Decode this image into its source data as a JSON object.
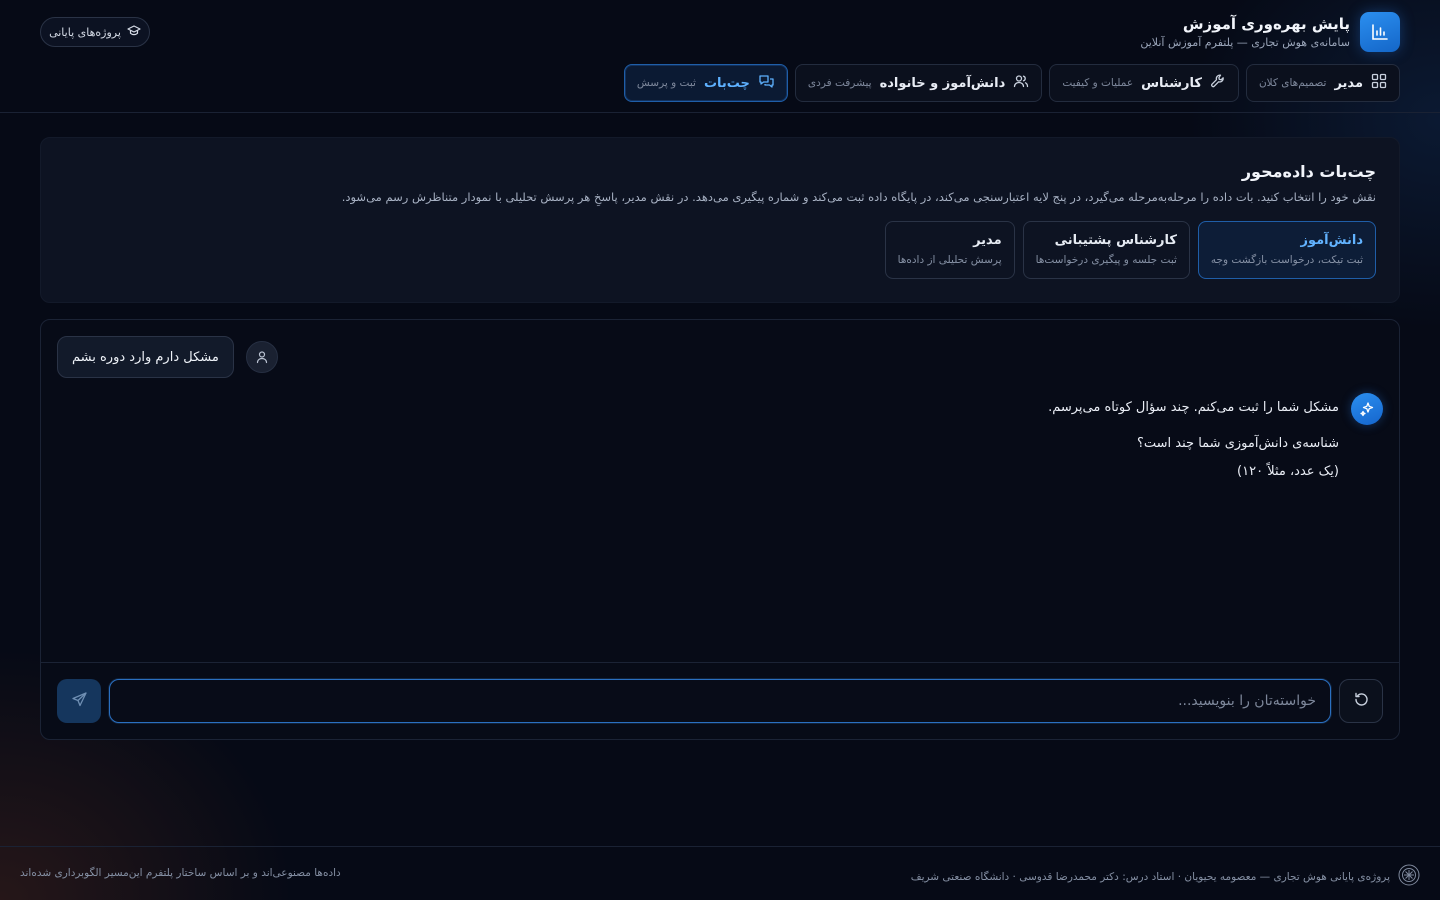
{
  "brand": {
    "title": "پایش بهره‌وری آموزش",
    "subtitle": "سامانه‌ی هوش تجاری — پلتفرم آموزش آنلاین",
    "icon": "bar-chart-icon"
  },
  "header": {
    "projects_label": "پروژه‌های پایانی"
  },
  "nav": {
    "tabs": [
      {
        "title": "مدیر",
        "subtitle": "تصمیم‌های کلان",
        "icon": "grid-icon",
        "active": false
      },
      {
        "title": "کارشناس",
        "subtitle": "عملیات و کیفیت",
        "icon": "wrench-icon",
        "active": false
      },
      {
        "title": "دانش‌آموز و خانواده",
        "subtitle": "پیشرفت فردی",
        "icon": "users-icon",
        "active": false
      },
      {
        "title": "چت‌بات",
        "subtitle": "ثبت و پرسش",
        "icon": "chat-icon",
        "active": true
      }
    ]
  },
  "intro": {
    "title": "چت‌بات داده‌محور",
    "description": "نقش خود را انتخاب کنید. بات داده را مرحله‌به‌مرحله می‌گیرد، در پنج لایه اعتبارسنجی می‌کند، در پایگاه داده ثبت می‌کند و شماره پیگیری می‌دهد. در نقش مدیر، پاسخِ هر پرسش تحلیلی با نمودار متناظرش رسم می‌شود.",
    "roles": [
      {
        "title": "دانش‌آموز",
        "subtitle": "ثبت تیکت، درخواست بازگشت وجه",
        "active": true
      },
      {
        "title": "کارشناس پشتیبانی",
        "subtitle": "ثبت جلسه و پیگیری درخواست‌ها",
        "active": false
      },
      {
        "title": "مدیر",
        "subtitle": "پرسش تحلیلی از داده‌ها",
        "active": false
      }
    ]
  },
  "chat": {
    "user_message": "مشکل دارم وارد دوره بشم",
    "bot_lines": [
      "مشکل شما را ثبت می‌کنم. چند سؤال کوتاه می‌پرسم.",
      "شناسه‌ی دانش‌آموزی شما چند است؟",
      "(یک عدد، مثلاً ۱۲۰)"
    ],
    "input_value": "",
    "input_placeholder": "خواسته‌تان را بنویسید..."
  },
  "footer": {
    "right_text": "پروژه‌ی پایانی هوش تجاری — معصومه یحیویان · استاد درس: دکتر محمدرضا قدوسی · دانشگاه صنعتی شریف",
    "left_text": "داده‌ها مصنوعی‌اند و بر اساس ساختار پلتفرم این‌مسیر الگوبرداری شده‌اند"
  },
  "colors": {
    "background": "#060a16",
    "accent": "#2b8ff0",
    "accent_text": "#5eb1ff",
    "card": "#0d1322"
  }
}
